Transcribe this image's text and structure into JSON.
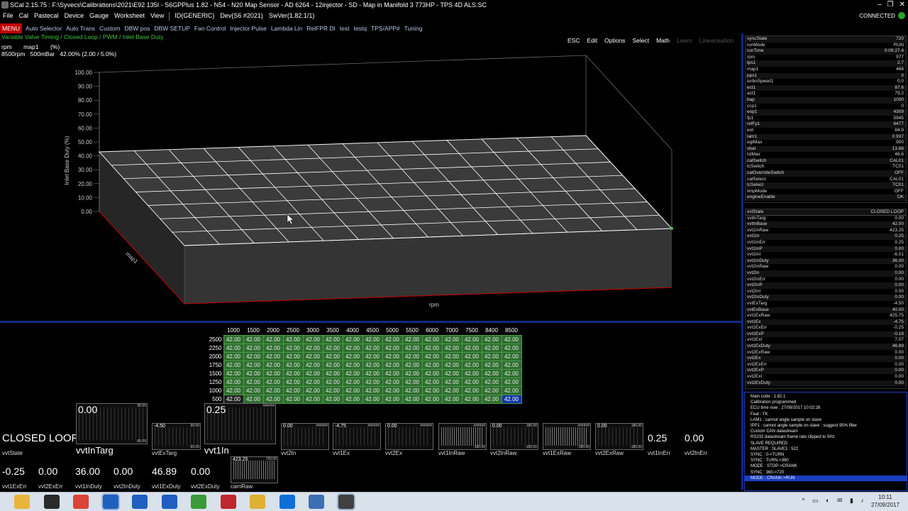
{
  "window": {
    "title": "SCal 2.15.75  :  F:\\Syvecs\\Calibrations\\2021\\E92 135I - S6GPPlus 1.82 - N54 - N20 Map Sensor - AD 6264 - 12injector - SD - Map in Manifold 3 773HP - TPS 4D ALS.SC",
    "controls": [
      "–",
      "❐",
      "✕"
    ]
  },
  "menubar": {
    "items": [
      "File",
      "Cal",
      "Pastecal",
      "Device",
      "Gauge",
      "Worksheet",
      "View"
    ],
    "id_text": "ID(GENERIC)",
    "dev_text": "Dev(S6 #2021)",
    "swver_text": "SwVer(1.82.1/1)",
    "connection": "CONNECTED"
  },
  "tabbar": {
    "menu_button": "MENU",
    "tabs": [
      "Auto Selector",
      "Auto Trans",
      "Custom",
      "DBW pos",
      "DBW SETUP",
      "Fan Control",
      "Injector Pulse",
      "Lambda Lin",
      "RelFPR DI",
      "test",
      "testq",
      "TPS/APP#",
      "Tuning"
    ]
  },
  "breadcrumb": "Variable Valve Timing / Closed Loop / PWM / Inlet Base Duty",
  "toolbar": {
    "buttons": [
      "ESC",
      "Edit",
      "Options",
      "Select",
      "Math",
      "Learn",
      "Linearisation"
    ]
  },
  "map_info": {
    "line1": "rpm       map1       (%)",
    "line2": "8500rpm   500mBar   42.00% (2.00 / 5.0%)"
  },
  "map3d": {
    "y_axis_label": "Inlet Base Duty (%)",
    "y_ticks": [
      "100.00",
      "90.00",
      "80.00",
      "70.00",
      "60.00",
      "50.00",
      "40.00",
      "30.00",
      "20.00",
      "10.00",
      "0.00"
    ],
    "x_axis_label": "rpm",
    "z_axis_label": "map1",
    "ylim": [
      0,
      100
    ],
    "surface_value": 42.0
  },
  "table": {
    "columns": [
      "1000",
      "1500",
      "2000",
      "2500",
      "3000",
      "3500",
      "4000",
      "4500",
      "5000",
      "5500",
      "6000",
      "7000",
      "7500",
      "8400",
      "8500"
    ],
    "rows": [
      {
        "label": "2500",
        "values": [
          "42.00",
          "42.00",
          "42.00",
          "42.00",
          "42.00",
          "42.00",
          "42.00",
          "42.00",
          "42.00",
          "42.00",
          "42.00",
          "42.00",
          "42.00",
          "42.00",
          "42.00"
        ]
      },
      {
        "label": "2250",
        "values": [
          "42.00",
          "42.00",
          "42.00",
          "42.00",
          "42.00",
          "42.00",
          "42.00",
          "42.00",
          "42.00",
          "42.00",
          "42.00",
          "42.00",
          "42.00",
          "42.00",
          "42.00"
        ]
      },
      {
        "label": "2000",
        "values": [
          "42.00",
          "42.00",
          "42.00",
          "42.00",
          "42.00",
          "42.00",
          "42.00",
          "42.00",
          "42.00",
          "42.00",
          "42.00",
          "42.00",
          "42.00",
          "42.00",
          "42.00"
        ]
      },
      {
        "label": "1750",
        "values": [
          "42.00",
          "42.00",
          "42.00",
          "42.00",
          "42.00",
          "42.00",
          "42.00",
          "42.00",
          "42.00",
          "42.00",
          "42.00",
          "42.00",
          "42.00",
          "42.00",
          "42.00"
        ]
      },
      {
        "label": "1500",
        "values": [
          "42.00",
          "42.00",
          "42.00",
          "42.00",
          "42.00",
          "42.00",
          "42.00",
          "42.00",
          "42.00",
          "42.00",
          "42.00",
          "42.00",
          "42.00",
          "42.00",
          "42.00"
        ]
      },
      {
        "label": "1250",
        "values": [
          "42.00",
          "42.00",
          "42.00",
          "42.00",
          "42.00",
          "42.00",
          "42.00",
          "42.00",
          "42.00",
          "42.00",
          "42.00",
          "42.00",
          "42.00",
          "42.00",
          "42.00"
        ]
      },
      {
        "label": "1000",
        "values": [
          "42.00",
          "42.00",
          "42.00",
          "42.00",
          "42.00",
          "42.00",
          "42.00",
          "42.00",
          "42.00",
          "42.00",
          "42.00",
          "42.00",
          "42.00",
          "42.00",
          "42.00"
        ]
      },
      {
        "label": "500",
        "values": [
          "42.00",
          "42.00",
          "42.00",
          "42.00",
          "42.00",
          "42.00",
          "42.00",
          "42.00",
          "42.00",
          "42.00",
          "42.00",
          "42.00",
          "42.00",
          "42.00",
          "42.00"
        ]
      }
    ]
  },
  "gauges": {
    "vvtState": {
      "value": "CLOSED LOOP",
      "label": "vvtState"
    },
    "vvtInTarg": {
      "value": "0.00",
      "label": "vvtInTarg",
      "max": "90.00",
      "min": "-90.00"
    },
    "vvtExTarg": {
      "value": "-4.50",
      "label": "vvtExTarg",
      "max": "90.00",
      "min": "-90.00"
    },
    "vvt1In": {
      "value": "0.25",
      "label": "vvt1In",
      "max": "######"
    },
    "vvt2In": {
      "value": "0.00",
      "label": "vvt2In",
      "max": "######"
    },
    "vvt1Ex": {
      "value": "-4.75",
      "label": "vvt1Ex",
      "max": "######"
    },
    "vvt2Ex": {
      "value": "0.00",
      "label": "vvt2Ex",
      "max": "######"
    },
    "vvt1InRaw": {
      "value": "",
      "label": "vvt1InRaw",
      "max": "######",
      "min": "-180.00"
    },
    "vvt2InRaw": {
      "value": "0.00",
      "label": "vvt2InRaw",
      "max": "180.00",
      "min": "-180.00"
    },
    "vvt1ExRaw": {
      "value": "",
      "label": "vvt1ExRaw",
      "max": "######",
      "min": "-180.00"
    },
    "vvt2ExRaw": {
      "value": "0.00",
      "label": "vvt2ExRaw",
      "max": "180.00",
      "min": "-180.00"
    },
    "vvt1InErr": {
      "value": "0.25",
      "label": "vvt1InErr"
    },
    "vvt2InErr": {
      "value": "0.00",
      "label": "vvt2InErr"
    },
    "vvt1ExErr": {
      "value": "-0.25",
      "label": "vvt1ExErr"
    },
    "vvt2ExErr": {
      "value": "0.00",
      "label": "vvt2ExErr"
    },
    "vvt1InDuty": {
      "value": "36.00",
      "label": "vvt1InDuty"
    },
    "vvt2InDuty": {
      "value": "0.00",
      "label": "vvt2InDuty"
    },
    "vvt1ExDuty": {
      "value": "46.89",
      "label": "vvt1ExDuty"
    },
    "vvt2ExDuty": {
      "value": "0.00",
      "label": "vvt2ExDuty"
    },
    "camRaw": {
      "value": "423.25",
      "label": "camRaw",
      "max": "720.00"
    }
  },
  "panel_top": [
    {
      "k": "syncState",
      "v": "720"
    },
    {
      "k": "runMode",
      "v": "RUN"
    },
    {
      "k": "runTime",
      "v": "0:09:27.4"
    },
    {
      "k": "rpm",
      "v": "977"
    },
    {
      "k": "tps1",
      "v": "2.7"
    },
    {
      "k": "map1",
      "v": "468"
    },
    {
      "k": "pps1",
      "v": "0"
    },
    {
      "k": "turboSpeed1",
      "v": "0.0"
    },
    {
      "k": "ect1",
      "v": "87.6"
    },
    {
      "k": "act1",
      "v": "79.2"
    },
    {
      "k": "bap",
      "v": "1000"
    },
    {
      "k": "ccp1",
      "v": "0"
    },
    {
      "k": "eop1",
      "v": "4309"
    },
    {
      "k": "fp1",
      "v": "5945"
    },
    {
      "k": "relFp1",
      "v": "6477"
    },
    {
      "k": "eot",
      "v": "84.9"
    },
    {
      "k": "lam1",
      "v": "0.937"
    },
    {
      "k": "egtMax",
      "v": "900"
    },
    {
      "k": "vbat",
      "v": "13.88"
    },
    {
      "k": "lstMax",
      "v": "46.6"
    },
    {
      "k": "calSwitch",
      "v": "CAL01"
    },
    {
      "k": "tcSwitch",
      "v": "TC01"
    },
    {
      "k": "calOverrideSwitch",
      "v": "OFF"
    },
    {
      "k": "calSelect",
      "v": "CAL01"
    },
    {
      "k": "tcSelect",
      "v": "TC01"
    },
    {
      "k": "limpMode",
      "v": "OFF"
    },
    {
      "k": "engineEnable",
      "v": "OK"
    }
  ],
  "panel_mid": [
    {
      "k": "vvtState",
      "v": "CLOSED LOOP"
    },
    {
      "k": "vvtInTarg",
      "v": "0.00"
    },
    {
      "k": "vvtInBase",
      "v": "42.00"
    },
    {
      "k": "vvt1InRaw",
      "v": "423.25"
    },
    {
      "k": "vvt1In",
      "v": "0.25"
    },
    {
      "k": "vvt1InErr",
      "v": "0.25"
    },
    {
      "k": "vvt1InP",
      "v": "0.00"
    },
    {
      "k": "vvt1InI",
      "v": "-6.01"
    },
    {
      "k": "vvt1InDuty",
      "v": "36.00"
    },
    {
      "k": "vvt2InRaw",
      "v": "0.00"
    },
    {
      "k": "vvt2In",
      "v": "0.00"
    },
    {
      "k": "vvt2InErr",
      "v": "0.00"
    },
    {
      "k": "vvt2InP",
      "v": "0.00"
    },
    {
      "k": "vvt2InI",
      "v": "0.00"
    },
    {
      "k": "vvt2InDuty",
      "v": "0.00"
    },
    {
      "k": "vvtExTarg",
      "v": "-4.50"
    },
    {
      "k": "vvtExBase",
      "v": "40.00"
    },
    {
      "k": "vvt1ExRaw",
      "v": "425.75"
    },
    {
      "k": "vvt1Ex",
      "v": "-4.75"
    },
    {
      "k": "vvt1ExErr",
      "v": "-0.25"
    },
    {
      "k": "vvt1ExP",
      "v": "-0.18"
    },
    {
      "k": "vvt1ExI",
      "v": "7.07"
    },
    {
      "k": "vvt1ExDuty",
      "v": "46.89"
    },
    {
      "k": "vvt2ExRaw",
      "v": "0.00"
    },
    {
      "k": "vvt2Ex",
      "v": "0.00"
    },
    {
      "k": "vvt2ExErr",
      "v": "0.00"
    },
    {
      "k": "vvt2ExP",
      "v": "0.00"
    },
    {
      "k": "vvt2ExI",
      "v": "0.00"
    },
    {
      "k": "vvt2ExDuty",
      "v": "0.00"
    }
  ],
  "log": [
    "Main code : 1.82.1",
    "Calibration programmed",
    "ECU time now : 27/09/2017 10:02:28",
    "Feat : TK",
    "LAM1 : cannot angle sample on slave",
    "IPP1 : cannot angle sample on slave : suggest 95% filter",
    "Custom CAN datastream",
    "RS232 datastream frame rate clipped to 5Hz",
    "SLAVE REQUIRED",
    "MASTER : SLAVE1 : 522",
    "SYNC : 0->TURN",
    "SYNC : TURN->360",
    "MODE : STOP->CRANK",
    "SYNC : 360->720",
    "MODE : CRANK->RUN"
  ],
  "taskbar": {
    "apps": [
      {
        "icon": "file-explorer-icon",
        "color": "#e8b43a"
      },
      {
        "icon": "task-manager-icon",
        "color": "#2a2a2a"
      },
      {
        "icon": "chrome-icon",
        "color": "#db4437"
      },
      {
        "icon": "scal-icon",
        "color": "#1f5fbf"
      },
      {
        "icon": "scal-icon",
        "color": "#1f5fbf"
      },
      {
        "icon": "scal-icon",
        "color": "#1f5fbf"
      },
      {
        "icon": "pen-icon",
        "color": "#3a9a3a"
      },
      {
        "icon": "filezilla-icon",
        "color": "#c0262d"
      },
      {
        "icon": "winscp-icon",
        "color": "#e0b030"
      },
      {
        "icon": "teamviewer-icon",
        "color": "#0e6ed8"
      },
      {
        "icon": "outlook-icon",
        "color": "#3c6eb4"
      },
      {
        "icon": "window-icon",
        "color": "#404040"
      }
    ],
    "tray": "^ ▭ ◐ ✉ ▮ ♪",
    "time": "10:11",
    "date": "27/09/2017"
  }
}
